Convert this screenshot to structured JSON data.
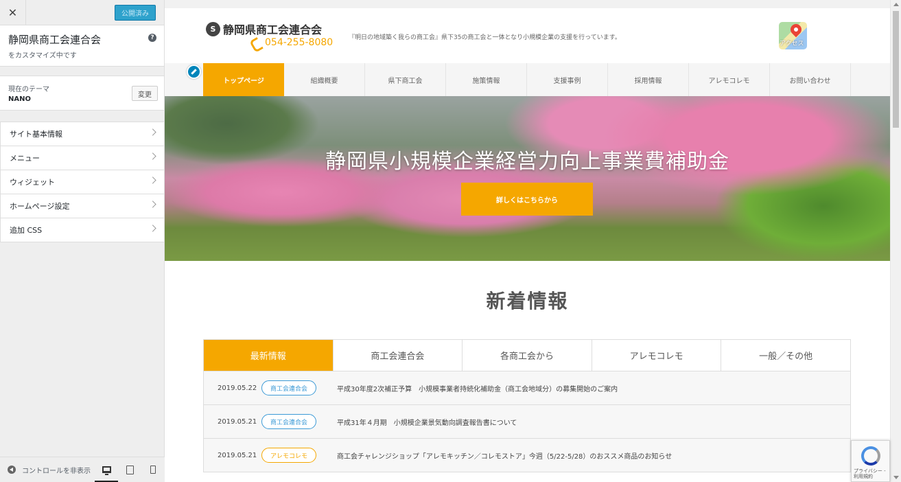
{
  "sidebar": {
    "publish_label": "公開済み",
    "site_title": "静岡県商工会連合会",
    "site_subtitle": "をカスタマイズ中です",
    "help_icon": "?",
    "theme_label": "現在のテーマ",
    "theme_name": "NANO",
    "change_label": "変更",
    "items": [
      {
        "label": "サイト基本情報"
      },
      {
        "label": "メニュー"
      },
      {
        "label": "ウィジェット"
      },
      {
        "label": "ホームページ設定"
      },
      {
        "label": "追加 CSS"
      }
    ],
    "hide_controls_label": "コントロールを非表示"
  },
  "site": {
    "logo_letter": "S",
    "logo_text": "静岡県商工会連合会",
    "phone": "054-255-8080",
    "tagline": "『明日の地域築く我らの商工会』県下35の商工会と一体となり小規模企業の支援を行っています。",
    "map_label": "アクセス",
    "nav": [
      {
        "label": "トップページ"
      },
      {
        "label": "組織概要"
      },
      {
        "label": "県下商工会"
      },
      {
        "label": "施策情報"
      },
      {
        "label": "支援事例"
      },
      {
        "label": "採用情報"
      },
      {
        "label": "アレモコレモ"
      },
      {
        "label": "お問い合わせ"
      }
    ],
    "hero_title": "静岡県小規模企業経営力向上事業費補助金",
    "hero_button": "詳しくはこちらから",
    "news_title": "新着情報",
    "news_tabs": [
      {
        "label": "最新情報"
      },
      {
        "label": "商工会連合会"
      },
      {
        "label": "各商工会から"
      },
      {
        "label": "アレモコレモ"
      },
      {
        "label": "一般／その他"
      }
    ],
    "news": [
      {
        "date": "2019.05.22",
        "badge": "商工会連合会",
        "text": "平成30年度2次補正予算　小規模事業者持続化補助金（商工会地域分）の募集開始のご案内"
      },
      {
        "date": "2019.05.21",
        "badge": "商工会連合会",
        "text": "平成31年４月期　小規模企業景気動向調査報告書について"
      },
      {
        "date": "2019.05.21",
        "badge": "アレモコレモ",
        "text": "商工会チャレンジショップ「アレモキッチン／コレモストア」今週（5/22-5/28）のおススメ商品のお知らせ"
      }
    ]
  },
  "recaptcha": {
    "label": "プライバシー - 利用規約"
  },
  "colors": {
    "accent": "#f5a700",
    "badge_blue": "#3c9ad6",
    "wp_blue": "#0085ba"
  }
}
